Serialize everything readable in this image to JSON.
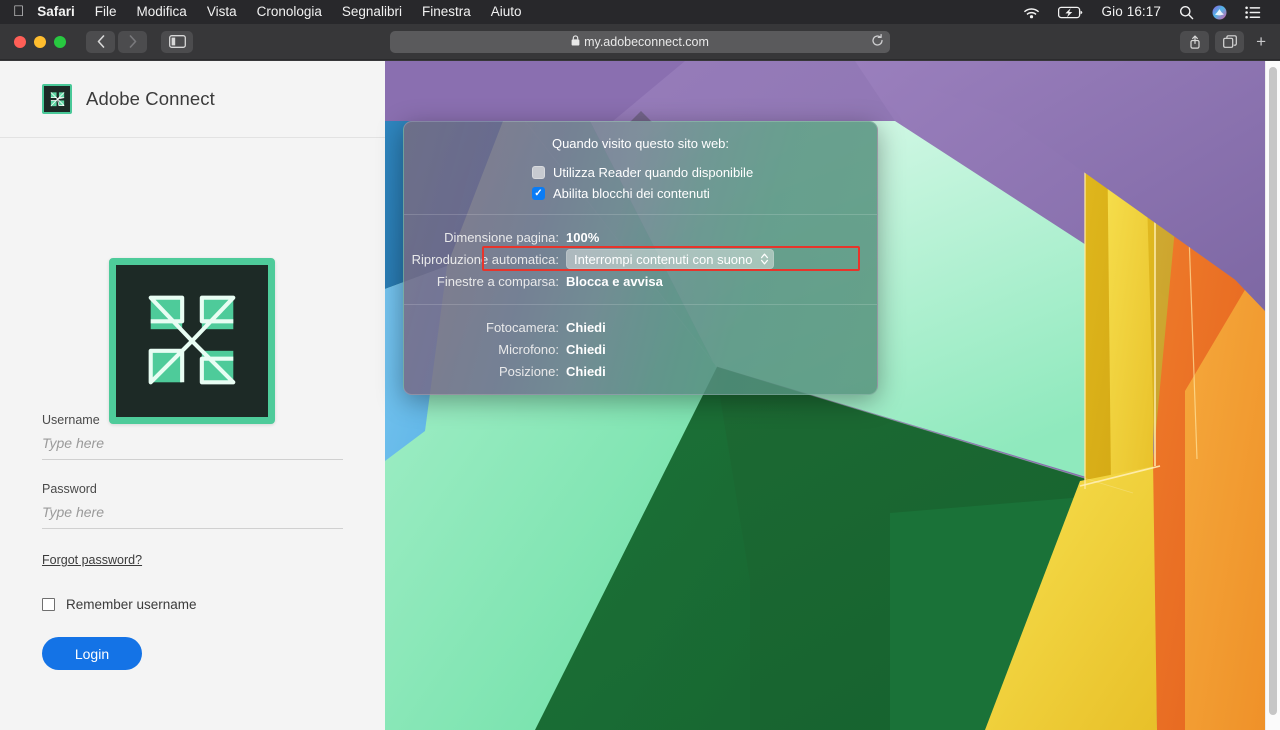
{
  "menubar": {
    "apple_icon": "apple-icon",
    "items": [
      {
        "label": "Safari",
        "bold": true
      },
      {
        "label": "File",
        "bold": false
      },
      {
        "label": "Modifica",
        "bold": false
      },
      {
        "label": "Vista",
        "bold": false
      },
      {
        "label": "Cronologia",
        "bold": false
      },
      {
        "label": "Segnalibri",
        "bold": false
      },
      {
        "label": "Finestra",
        "bold": false
      },
      {
        "label": "Aiuto",
        "bold": false
      }
    ],
    "status": {
      "wifi_icon": "wifi-icon",
      "battery_icon": "battery-charging-icon",
      "clock": "Gio 16:17",
      "search_icon": "spotlight-search-icon",
      "siri_icon": "siri-icon",
      "control_center_icon": "control-center-icon"
    }
  },
  "toolbar": {
    "back_icon": "chevron-left-icon",
    "forward_icon": "chevron-right-icon",
    "sidebar_icon": "sidebar-toggle-icon",
    "url": "my.adobeconnect.com",
    "lock_icon": "lock-icon",
    "reload_icon": "reload-icon",
    "share_icon": "share-icon",
    "tab_overview_icon": "tab-overview-icon",
    "new_tab_label": "+"
  },
  "popover": {
    "title": "Quando visito questo sito web:",
    "checkboxes": [
      {
        "label": "Utilizza Reader quando disponibile",
        "checked": false
      },
      {
        "label": "Abilita blocchi dei contenuti",
        "checked": true
      }
    ],
    "settings": [
      {
        "label": "Dimensione pagina:",
        "value": "100%",
        "type": "text"
      },
      {
        "label": "Riproduzione automatica:",
        "value": "Interrompi contenuti con suono",
        "type": "select",
        "highlighted": true
      },
      {
        "label": "Finestre a comparsa:",
        "value": "Blocca e avvisa",
        "type": "text"
      }
    ],
    "permissions": [
      {
        "label": "Fotocamera:",
        "value": "Chiedi"
      },
      {
        "label": "Microfono:",
        "value": "Chiedi"
      },
      {
        "label": "Posizione:",
        "value": "Chiedi"
      }
    ],
    "highlight_color": "#e8342b"
  },
  "login": {
    "brand_title": "Adobe Connect",
    "logo_icon": "adobe-connect-logo-icon",
    "username": {
      "label": "Username",
      "placeholder": "Type here",
      "value": ""
    },
    "password": {
      "label": "Password",
      "placeholder": "Type here",
      "value": ""
    },
    "forgot_link": "Forgot password?",
    "remember": {
      "label": "Remember username",
      "checked": false
    },
    "login_button": "Login",
    "accent_color": "#1473e6",
    "brand_green": "#4ecb9a"
  }
}
